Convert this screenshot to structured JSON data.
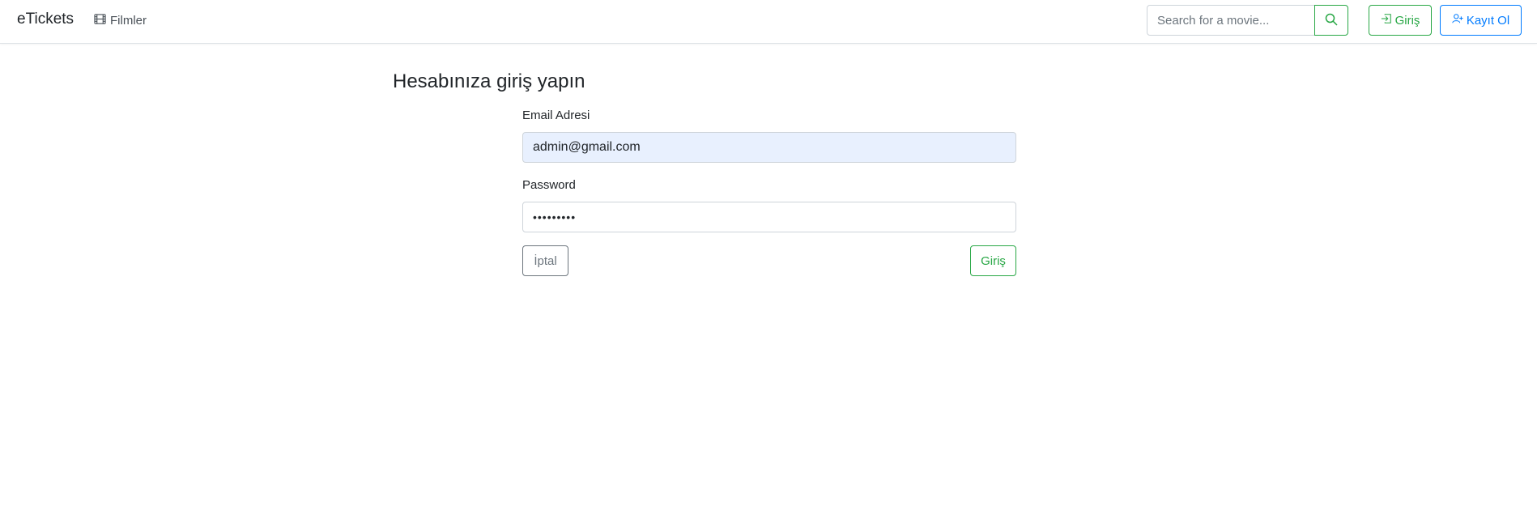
{
  "navbar": {
    "brand": "eTickets",
    "movies_link": "Filmler",
    "search_placeholder": "Search for a movie...",
    "login_label": "Giriş",
    "register_label": "Kayıt Ol"
  },
  "login_form": {
    "title": "Hesabınıza giriş yapın",
    "email_label": "Email Adresi",
    "email_value": "admin@gmail.com",
    "password_label": "Password",
    "password_value": "•••••••••",
    "cancel_label": "İptal",
    "submit_label": "Giriş"
  },
  "colors": {
    "success": "#28a745",
    "primary": "#007bff",
    "secondary": "#6c757d",
    "autofill": "#e8f0fe"
  },
  "icons": {
    "movies": "film-icon",
    "search": "search-icon",
    "login": "login-icon",
    "register": "person-add-icon"
  }
}
